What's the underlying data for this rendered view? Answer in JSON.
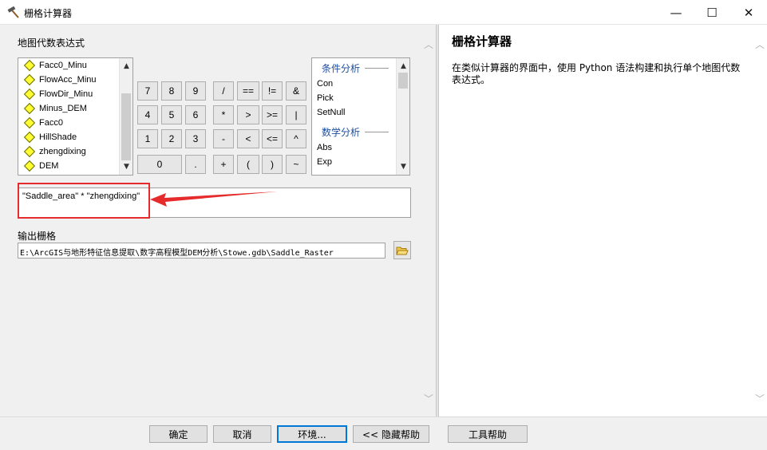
{
  "window": {
    "title": "栅格计算器",
    "minimize": "—",
    "maximize": "☐",
    "close": "✕"
  },
  "left": {
    "expression_label": "地图代数表达式",
    "layers": [
      "Facc0_Minu",
      "FlowAcc_Minu",
      "FlowDir_Minu",
      "Minus_DEM",
      "Facc0",
      "HillShade",
      "zhengdixing",
      "DEM"
    ],
    "keypad": {
      "row1": [
        "7",
        "8",
        "9",
        "/",
        "==",
        "!=",
        "&"
      ],
      "row2": [
        "4",
        "5",
        "6",
        "*",
        ">",
        ">=",
        "|"
      ],
      "row3": [
        "1",
        "2",
        "3",
        "-",
        "<",
        "<=",
        "^"
      ],
      "row4": [
        "0",
        ".",
        "+",
        "(",
        ")",
        "~"
      ]
    },
    "functions": {
      "group1": "条件分析",
      "group1_items": [
        "Con",
        "Pick",
        "SetNull"
      ],
      "group2": "数学分析",
      "group2_items": [
        "Abs",
        "Exp"
      ]
    },
    "expression": "\"Saddle_area\" * \"zhengdixing\"",
    "output_label": "输出栅格",
    "output_path": "E:\\ArcGIS与地形特征信息提取\\数字高程模型DEM分析\\Stowe.gdb\\Saddle_Raster"
  },
  "help": {
    "title": "栅格计算器",
    "description": "在类似计算器的界面中，使用 Python 语法构建和执行单个地图代数表达式。"
  },
  "buttons": {
    "ok": "确定",
    "cancel": "取消",
    "env": "环境...",
    "hide_help": "<< 隐藏帮助",
    "tool_help": "工具帮助"
  },
  "colors": {
    "highlight": "#e52b2b",
    "layer_icon": "#ffff33",
    "func_heading": "#1f4fa0"
  }
}
